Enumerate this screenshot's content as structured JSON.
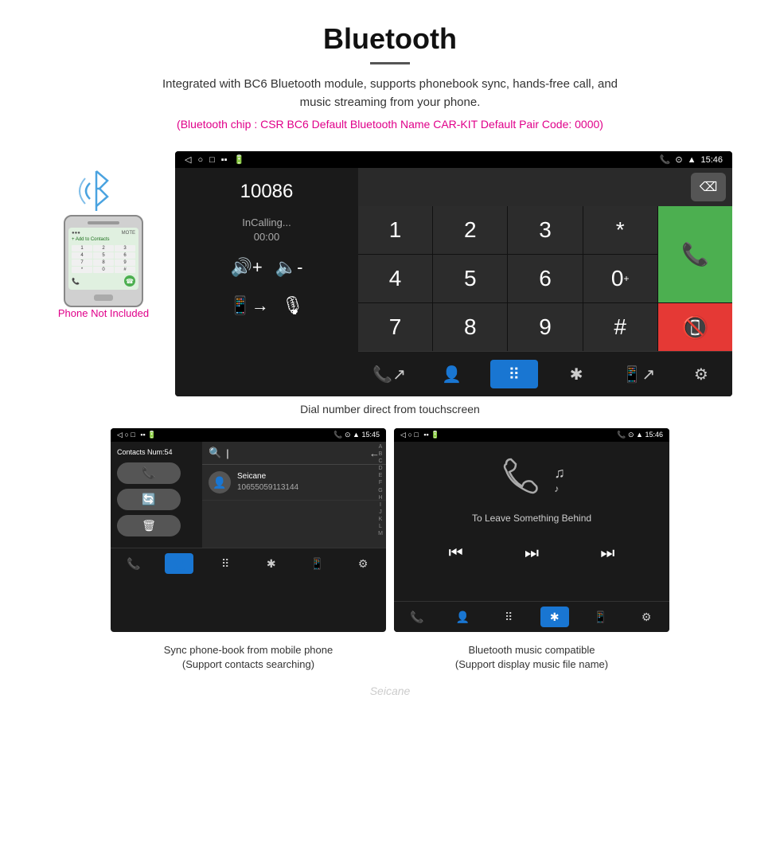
{
  "header": {
    "title": "Bluetooth",
    "description": "Integrated with BC6 Bluetooth module, supports phonebook sync, hands-free call, and music streaming from your phone.",
    "specs": "(Bluetooth chip : CSR BC6    Default Bluetooth Name CAR-KIT    Default Pair Code: 0000)"
  },
  "phone_label": "Phone Not Included",
  "main_screen": {
    "statusbar": {
      "time": "15:46",
      "icons_left": [
        "back-arrow",
        "rect-icon",
        "square-icon",
        "sim-icon",
        "battery-icon"
      ],
      "icons_right": [
        "phone-icon",
        "location-icon",
        "wifi-icon",
        "time"
      ]
    },
    "dial_number": "10086",
    "call_status": "InCalling...",
    "call_timer": "00:00",
    "numpad": [
      "1",
      "2",
      "3",
      "*",
      "4",
      "5",
      "6",
      "0+",
      "7",
      "8",
      "9",
      "#"
    ],
    "green_btn": "call",
    "red_btn": "end-call"
  },
  "caption_main": "Dial number direct from touchscreen",
  "contacts_screen": {
    "statusbar_time": "15:45",
    "contacts_num_label": "Contacts Num:54",
    "contact_name": "Seicane",
    "contact_number": "10655059113144",
    "alphabet": [
      "A",
      "B",
      "C",
      "D",
      "E",
      "F",
      "G",
      "H",
      "I",
      "J",
      "K",
      "L",
      "M"
    ]
  },
  "music_screen": {
    "statusbar_time": "15:46",
    "song_title": "To Leave Something Behind"
  },
  "captions": {
    "left": "Sync phone-book from mobile phone\n(Support contacts searching)",
    "right": "Bluetooth music compatible\n(Support display music file name)"
  },
  "watermark": "Seicane",
  "nav_items": [
    "phone-transfer",
    "contacts",
    "dialpad",
    "bluetooth",
    "transfer",
    "settings"
  ],
  "small_nav_items": {
    "contacts": [
      "phone-transfer",
      "contacts",
      "dialpad",
      "bluetooth",
      "transfer",
      "settings"
    ],
    "music": [
      "phone-transfer",
      "contacts",
      "dialpad",
      "bluetooth",
      "transfer",
      "settings"
    ]
  }
}
